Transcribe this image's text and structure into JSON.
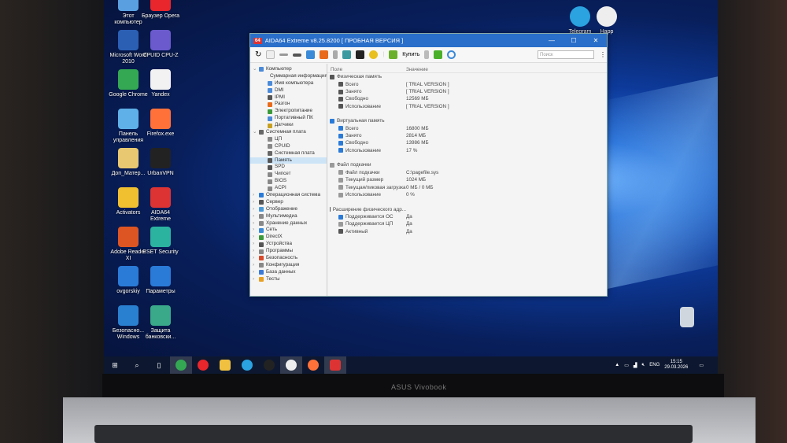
{
  "desktop": {
    "icons_left": [
      {
        "label": "Этот компьютер",
        "color": "#5aa0e0"
      },
      {
        "label": "Браузер Opera",
        "color": "#e8262b"
      },
      {
        "label": "Microsoft Word 2010",
        "color": "#2b5fb4"
      },
      {
        "label": "CPUID CPU-Z",
        "color": "#6a5acd"
      },
      {
        "label": "Google Chrome",
        "color": "#34a853"
      },
      {
        "label": "Yandex",
        "color": "#f2f2f2"
      },
      {
        "label": "Панель управления",
        "color": "#5fb0e8"
      },
      {
        "label": "Firefox.exe",
        "color": "#ff7139"
      },
      {
        "label": "Доп_Матер...",
        "color": "#e8c870"
      },
      {
        "label": "UrbanVPN",
        "color": "#222"
      },
      {
        "label": "Activators",
        "color": "#f0c030"
      },
      {
        "label": "AIDA64 Extreme",
        "color": "#d33"
      },
      {
        "label": "Adobe Reader XI",
        "color": "#d52"
      },
      {
        "label": "ESET Security",
        "color": "#2bb3a0"
      },
      {
        "label": "ovgorskiy",
        "color": "#2a7bd8"
      },
      {
        "label": "Параметры",
        "color": "#2a7bd8"
      },
      {
        "label": "Безопасно... Windows",
        "color": "#2a80d0"
      },
      {
        "label": "Защита банковски...",
        "color": "#3aa98a"
      }
    ],
    "icons_right": [
      {
        "label": "Telegram",
        "color": "#2aa3e0"
      },
      {
        "label": "Happ",
        "color": "#eee"
      }
    ],
    "recycle_bin": "Корзина"
  },
  "window": {
    "title": "AIDA64 Extreme v8.25.8200  [ ПРОБНАЯ ВЕРСИЯ ]",
    "logo": "64",
    "buy_label": "Купить",
    "search_placeholder": "Поиск",
    "tree": [
      {
        "label": "Компьютер",
        "lvl": 0,
        "exp": "v",
        "c": "#4a8ad8"
      },
      {
        "label": "Суммарная информация",
        "lvl": 1,
        "c": "#4a8ad8"
      },
      {
        "label": "Имя компьютера",
        "lvl": 1,
        "c": "#4a8ad8"
      },
      {
        "label": "DMI",
        "lvl": 1,
        "c": "#4a8ad8"
      },
      {
        "label": "IPMI",
        "lvl": 1,
        "c": "#555"
      },
      {
        "label": "Разгон",
        "lvl": 1,
        "c": "#e86a1a"
      },
      {
        "label": "Электропитание",
        "lvl": 1,
        "c": "#3a9a3a"
      },
      {
        "label": "Портативный ПК",
        "lvl": 1,
        "c": "#4a8ad8"
      },
      {
        "label": "Датчики",
        "lvl": 1,
        "c": "#c8a020"
      },
      {
        "label": "Системная плата",
        "lvl": 0,
        "exp": "v",
        "c": "#666"
      },
      {
        "label": "ЦП",
        "lvl": 1,
        "c": "#888"
      },
      {
        "label": "CPUID",
        "lvl": 1,
        "c": "#888"
      },
      {
        "label": "Системная плата",
        "lvl": 1,
        "c": "#666"
      },
      {
        "label": "Память",
        "lvl": 1,
        "c": "#555",
        "sel": true
      },
      {
        "label": "SPD",
        "lvl": 1,
        "c": "#555"
      },
      {
        "label": "Чипсет",
        "lvl": 1,
        "c": "#888"
      },
      {
        "label": "BIOS",
        "lvl": 1,
        "c": "#888"
      },
      {
        "label": "ACPI",
        "lvl": 1,
        "c": "#888"
      },
      {
        "label": "Операционная система",
        "lvl": 0,
        "exp": ">",
        "c": "#2a7bd8"
      },
      {
        "label": "Сервер",
        "lvl": 0,
        "exp": ">",
        "c": "#555"
      },
      {
        "label": "Отображение",
        "lvl": 0,
        "exp": ">",
        "c": "#4a9ad8"
      },
      {
        "label": "Мультимедиа",
        "lvl": 0,
        "exp": ">",
        "c": "#888"
      },
      {
        "label": "Хранение данных",
        "lvl": 0,
        "exp": ">",
        "c": "#888"
      },
      {
        "label": "Сеть",
        "lvl": 0,
        "exp": ">",
        "c": "#3a8ad8"
      },
      {
        "label": "DirectX",
        "lvl": 0,
        "exp": ">",
        "c": "#3a9a3a"
      },
      {
        "label": "Устройства",
        "lvl": 0,
        "exp": ">",
        "c": "#555"
      },
      {
        "label": "Программы",
        "lvl": 0,
        "exp": ">",
        "c": "#888"
      },
      {
        "label": "Безопасность",
        "lvl": 0,
        "exp": ">",
        "c": "#d84a2a"
      },
      {
        "label": "Конфигурация",
        "lvl": 0,
        "exp": ">",
        "c": "#888"
      },
      {
        "label": "База данных",
        "lvl": 0,
        "exp": ">",
        "c": "#3a7ad8"
      },
      {
        "label": "Тесты",
        "lvl": 0,
        "exp": ">",
        "c": "#e8a020"
      }
    ],
    "columns": {
      "field": "Поле",
      "value": "Значение"
    },
    "rows": [
      {
        "f": "Физическая память",
        "v": "",
        "lvl": 0,
        "c": "#555"
      },
      {
        "f": "Всего",
        "v": "[ TRIAL VERSION ]",
        "lvl": 1,
        "c": "#555"
      },
      {
        "f": "Занято",
        "v": "[ TRIAL VERSION ]",
        "lvl": 1,
        "c": "#555"
      },
      {
        "f": "Свободно",
        "v": "12569 МБ",
        "lvl": 1,
        "c": "#555"
      },
      {
        "f": "Использование",
        "v": "[ TRIAL VERSION ]",
        "lvl": 1,
        "c": "#555"
      },
      {
        "f": "",
        "v": "",
        "lvl": 0
      },
      {
        "f": "Виртуальная память",
        "v": "",
        "lvl": 0,
        "c": "#2a7bd8"
      },
      {
        "f": "Всего",
        "v": "16800 МБ",
        "lvl": 1,
        "c": "#2a7bd8"
      },
      {
        "f": "Занято",
        "v": "2814 МБ",
        "lvl": 1,
        "c": "#2a7bd8"
      },
      {
        "f": "Свободно",
        "v": "13986 МБ",
        "lvl": 1,
        "c": "#2a7bd8"
      },
      {
        "f": "Использование",
        "v": "17 %",
        "lvl": 1,
        "c": "#2a7bd8"
      },
      {
        "f": "",
        "v": "",
        "lvl": 0
      },
      {
        "f": "Файл подкачки",
        "v": "",
        "lvl": 0,
        "c": "#999"
      },
      {
        "f": "Файл подкачки",
        "v": "C:\\pagefile.sys",
        "lvl": 1,
        "c": "#999"
      },
      {
        "f": "Текущий размер",
        "v": "1024 МБ",
        "lvl": 1,
        "c": "#999"
      },
      {
        "f": "Текущая/пиковая загрузка",
        "v": "0 МБ / 0 МБ",
        "lvl": 1,
        "c": "#999"
      },
      {
        "f": "Использование",
        "v": "0 %",
        "lvl": 1,
        "c": "#999"
      },
      {
        "f": "",
        "v": "",
        "lvl": 0
      },
      {
        "f": "Расширение физического адр...",
        "v": "",
        "lvl": 0,
        "c": "#555"
      },
      {
        "f": "Поддерживается ОС",
        "v": "Да",
        "lvl": 1,
        "c": "#2a7bd8"
      },
      {
        "f": "Поддерживается ЦП",
        "v": "Да",
        "lvl": 1,
        "c": "#999"
      },
      {
        "f": "Активный",
        "v": "Да",
        "lvl": 1,
        "c": "#555"
      }
    ]
  },
  "taskbar": {
    "apps": [
      {
        "n": "chrome",
        "c": "#34a853"
      },
      {
        "n": "opera",
        "c": "#e8262b"
      },
      {
        "n": "explorer",
        "c": "#f0c040"
      },
      {
        "n": "telegram",
        "c": "#2aa3e0"
      },
      {
        "n": "urbanvpn",
        "c": "#222"
      },
      {
        "n": "yandex",
        "c": "#eee"
      },
      {
        "n": "firefox",
        "c": "#ff7139"
      },
      {
        "n": "aida64",
        "c": "#d33"
      }
    ],
    "lang": "ENG",
    "time": "15:15",
    "date": "29.03.2026"
  },
  "laptop_brand": "ASUS Vivobook"
}
